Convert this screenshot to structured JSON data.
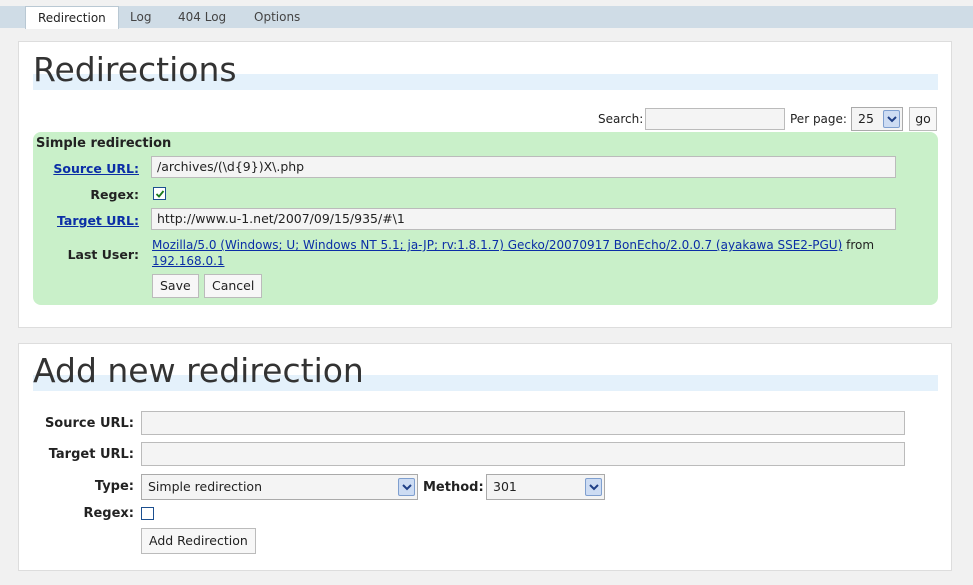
{
  "tabs": [
    {
      "label": "Redirection",
      "active": true
    },
    {
      "label": "Log",
      "active": false
    },
    {
      "label": "404 Log",
      "active": false
    },
    {
      "label": "Options",
      "active": false
    }
  ],
  "redirections_panel": {
    "title": "Redirections",
    "search_label": "Search:",
    "search_value": "",
    "per_page_label": "Per page:",
    "per_page_value": "25",
    "go_label": "go",
    "item": {
      "type_heading": "Simple redirection",
      "source_label": "Source URL:",
      "source_value": "/archives/(\\d{9})X\\.php",
      "regex_label": "Regex:",
      "regex_checked": true,
      "target_label": "Target URL:",
      "target_value": "http://www.u-1.net/2007/09/15/935/#\\1",
      "last_user_label": "Last User:",
      "last_user_agent": "Mozilla/5.0 (Windows; U; Windows NT 5.1; ja-JP; rv:1.8.1.7) Gecko/20070917 BonEcho/2.0.0.7 (ayakawa SSE2-PGU)",
      "last_user_from": "from",
      "last_user_ip": "192.168.0.1",
      "save_label": "Save",
      "cancel_label": "Cancel"
    }
  },
  "add_panel": {
    "title": "Add new redirection",
    "source_label": "Source URL:",
    "source_value": "",
    "target_label": "Target URL:",
    "target_value": "",
    "type_label": "Type:",
    "type_value": "Simple redirection",
    "method_label": "Method:",
    "method_value": "301",
    "regex_label": "Regex:",
    "regex_checked": false,
    "add_button_label": "Add Redirection"
  },
  "colors": {
    "tabbar": "#cfdce6",
    "green_box": "#c9f0c9",
    "heading_band": "#e4f1fb",
    "link": "#0b2ea6"
  },
  "icons": {
    "dropdown": "chevron-down-icon",
    "checkbox_checked": "checkmark-icon"
  }
}
